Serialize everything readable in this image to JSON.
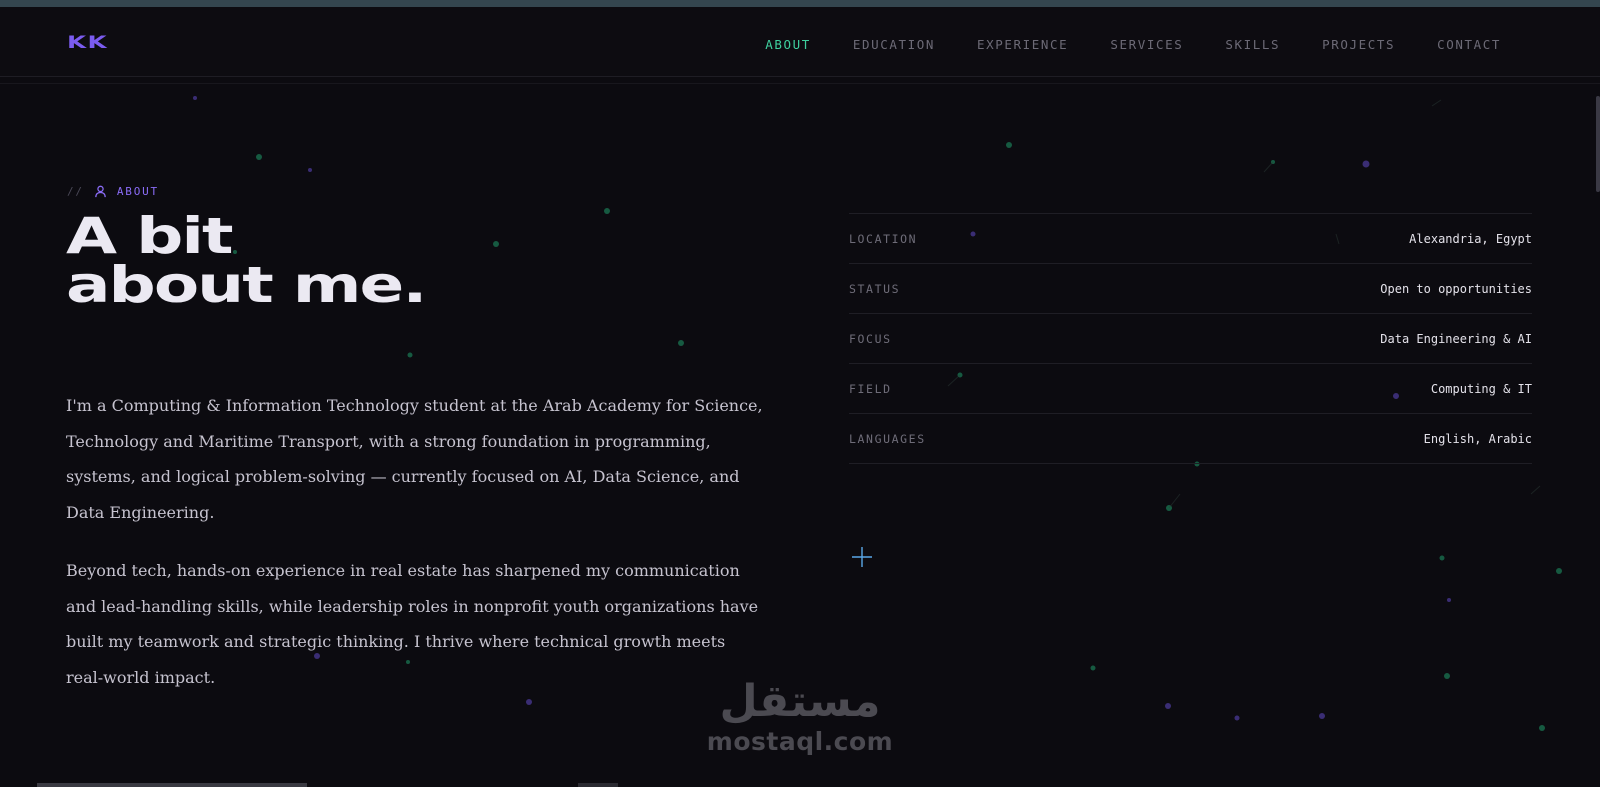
{
  "brand": {
    "logo": "KK",
    "accent": "#7b5cf0"
  },
  "nav": {
    "items": [
      "ABOUT",
      "EDUCATION",
      "EXPERIENCE",
      "SERVICES",
      "SKILLS",
      "PROJECTS",
      "CONTACT"
    ],
    "active": "ABOUT",
    "active_color": "#3ecf9e"
  },
  "section": {
    "eyebrow_prefix": "//",
    "eyebrow_icon": "user-icon",
    "eyebrow_label": "ABOUT",
    "title_line1": "A bit",
    "title_line2": "about me."
  },
  "bio": {
    "p1": "I'm a Computing & Information Technology student at the Arab Academy for Science, Technology and Maritime Transport, with a strong foundation in programming, systems, and logical problem-solving — currently focused on AI, Data Science, and Data Engineering.",
    "p2": "Beyond tech, hands-on experience in real estate has sharpened my communication and lead-handling skills, while leadership roles in nonprofit youth organizations have built my teamwork and strategic thinking. I thrive where technical growth meets real-world impact."
  },
  "facts": [
    {
      "key": "LOCATION",
      "value": "Alexandria, Egypt"
    },
    {
      "key": "STATUS",
      "value": "Open to opportunities"
    },
    {
      "key": "FOCUS",
      "value": "Data Engineering & AI"
    },
    {
      "key": "FIELD",
      "value": "Computing & IT"
    },
    {
      "key": "LANGUAGES",
      "value": "English, Arabic"
    }
  ],
  "watermark": {
    "arabic": "مستقل",
    "latin": "mostaql.com"
  }
}
